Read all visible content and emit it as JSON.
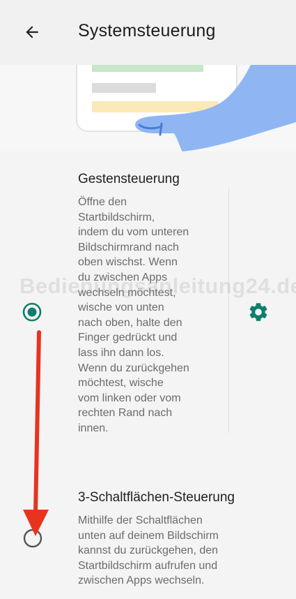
{
  "appbar": {
    "title": "Systemsteuerung",
    "back_icon": "arrow-left-icon"
  },
  "options": [
    {
      "title": "Gestensteuerung",
      "description": "Öffne den\nStartbildschirm,\nindem du vom unteren\nBildschirmrand nach\noben wischst. Wenn\ndu zwischen Apps\nwechseln möchtest,\nwische von unten\nnach oben, halte den\nFinger gedrückt und\nlass ihn dann los.\nWenn du zurückgehen\nmöchtest, wische\nvom linken oder vom\nrechten Rand nach\ninnen.",
      "selected": true,
      "settings_icon": "gear-icon"
    },
    {
      "title": "3-Schaltflächen-Steuerung",
      "description": "Mithilfe der Schaltflächen\nunten auf deinem Bildschirm\nkannst du zurückgehen, den\nStartbildschirm aufrufen und\nzwischen Apps wechseln.",
      "selected": false
    }
  ],
  "watermark": "Bedienungsanleitung24.de",
  "colors": {
    "accent": "#0f7e6c",
    "annotation_arrow": "#e8331f"
  }
}
